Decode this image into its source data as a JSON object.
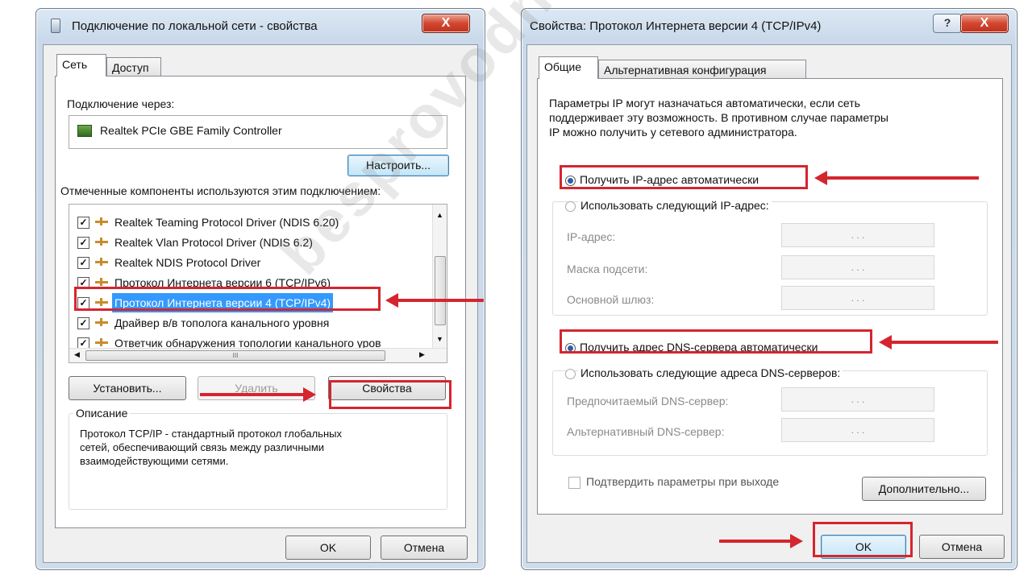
{
  "watermark": "besprovodnik.ru",
  "left_dialog": {
    "title": "Подключение по локальной сети - свойства",
    "close_label": "X",
    "tabs": [
      "Сеть",
      "Доступ"
    ],
    "connect_via_label": "Подключение через:",
    "adapter_name": "Realtek PCIe GBE Family Controller",
    "configure_button": "Настроить...",
    "components_label": "Отмеченные компоненты используются этим подключением:",
    "components": [
      "Realtek Teaming Protocol Driver (NDIS 6.20)",
      "Realtek Vlan Protocol Driver (NDIS 6.2)",
      "Realtek NDIS Protocol Driver",
      "Протокол Интернета версии 6 (TCP/IPv6)",
      "Протокол Интернета версии 4 (TCP/IPv4)",
      "Драйвер в/в тополога канального уровня",
      "Ответчик обнаружения топологии канального уров"
    ],
    "hscroll_grip": "III",
    "install_button": "Установить...",
    "remove_button": "Удалить",
    "properties_button": "Свойства",
    "description_label": "Описание",
    "description_text": [
      "Протокол TCP/IP - стандартный протокол глобальных",
      "сетей, обеспечивающий связь между различными",
      "взаимодействующими сетями."
    ],
    "ok_button": "OK",
    "cancel_button": "Отмена"
  },
  "right_dialog": {
    "title": "Свойства: Протокол Интернета версии 4 (TCP/IPv4)",
    "help_label": "?",
    "close_label": "X",
    "tabs": [
      "Общие",
      "Альтернативная конфигурация"
    ],
    "intro_text": [
      "Параметры IP могут назначаться автоматически, если сеть",
      "поддерживает эту возможность. В противном случае параметры",
      "IP можно получить у сетевого администратора."
    ],
    "auto_ip_option": "Получить IP-адрес автоматически",
    "manual_ip_option": "Использовать следующий IP-адрес:",
    "ip_address_label": "IP-адрес:",
    "subnet_mask_label": "Маска подсети:",
    "gateway_label": "Основной шлюз:",
    "ip_dots": ". . .",
    "auto_dns_option": "Получить адрес DNS-сервера автоматически",
    "manual_dns_option": "Использовать следующие адреса DNS-серверов:",
    "preferred_dns_label": "Предпочитаемый DNS-сервер:",
    "alternate_dns_label": "Альтернативный DNS-сервер:",
    "validate_label": "Подтвердить параметры при выходе",
    "advanced_button": "Дополнительно...",
    "ok_button": "OK",
    "cancel_button": "Отмена"
  }
}
